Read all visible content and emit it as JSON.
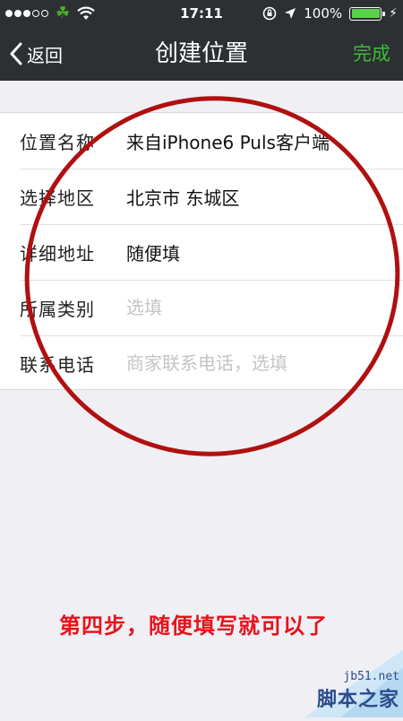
{
  "status_bar": {
    "carrier_icon": "clover-icon",
    "time": "17:11",
    "battery": "100%",
    "battery_level": 1.0,
    "battery_color": "#5bd14a"
  },
  "nav": {
    "back_label": "返回",
    "title": "创建位置",
    "done_label": "完成",
    "done_color": "#3fba3c"
  },
  "form": {
    "rows": [
      {
        "label": "位置名称",
        "value": "来自iPhone6 Puls客户端",
        "placeholder": ""
      },
      {
        "label": "选择地区",
        "value": "北京市 东城区",
        "placeholder": ""
      },
      {
        "label": "详细地址",
        "value": "随便填",
        "placeholder": ""
      },
      {
        "label": "所属类别",
        "value": "",
        "placeholder": "选填"
      },
      {
        "label": "联系电话",
        "value": "",
        "placeholder": "商家联系电话，选填"
      }
    ]
  },
  "annotation": {
    "circle_color": "#b01010",
    "instruction": "第四步，随便填写就可以了",
    "instruction_color": "#e8121a"
  },
  "watermark": {
    "url": "jb51.net",
    "name": "脚本之家"
  }
}
